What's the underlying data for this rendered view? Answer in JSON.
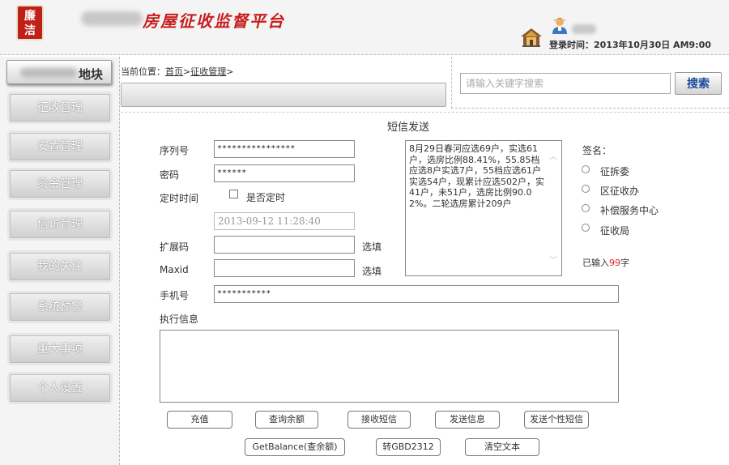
{
  "header": {
    "logo_chars": [
      "廉",
      "洁"
    ],
    "site_title": "房屋征收监督平台",
    "login_time": "登录时间：2013年10月30日 AM9:00"
  },
  "sidebar": {
    "block_label": "地块",
    "items": [
      {
        "label": "征收管理"
      },
      {
        "label": "安置管理"
      },
      {
        "label": "资金管理"
      },
      {
        "label": "信访管理"
      },
      {
        "label": "我的关注"
      },
      {
        "label": "系统预警"
      },
      {
        "label": "重大事项"
      },
      {
        "label": "个人设置"
      }
    ]
  },
  "breadcrumb": {
    "prefix": "当前位置：",
    "home": "首页",
    "sep1": ">",
    "current": "征收管理",
    "sep2": ">"
  },
  "search": {
    "placeholder": "请输入关键字搜索",
    "button_label": "搜索"
  },
  "form": {
    "title": "短信发送",
    "serial_label": "序列号",
    "serial_value": "****************",
    "password_label": "密码",
    "password_value": "******",
    "schedule_label": "定时时间",
    "schedule_checkbox_label": "是否定时",
    "datetime_value": "2013-09-12    11:28:40",
    "ext_label": "扩展码",
    "ext_hint": "选填",
    "maxid_label": "Maxid",
    "maxid_hint": "选填",
    "phone_label": "手机号",
    "phone_value": "***********",
    "exec_label": "执行信息",
    "message_text": "8月29日春河应选69户，实选61户，选房比例88.41%，55.85档应选8户实选7户，55档应选61户实选54户，现累计应选502户，实41户，未51户，选房比例90.02%。二轮选房累计209户",
    "signature_label": "签名：",
    "signature_options": [
      "征拆委",
      "区征收办",
      "补偿服务中心",
      "征收局"
    ],
    "count_prefix": "已输入",
    "count_value": "99",
    "count_suffix": "字"
  },
  "buttons": {
    "recharge": "充值",
    "query_balance": "查询余额",
    "receive_sms": "接收短信",
    "send_info": "发送信息",
    "send_personal": "发送个性短信",
    "get_balance": "GetBalance(查余额)",
    "to_gbk": "转GBD2312",
    "clear_text": "清空文本"
  },
  "colors": {
    "title_red": "#c81e1e",
    "search_blue": "#1a4a9a",
    "count_red": "#e02020"
  }
}
